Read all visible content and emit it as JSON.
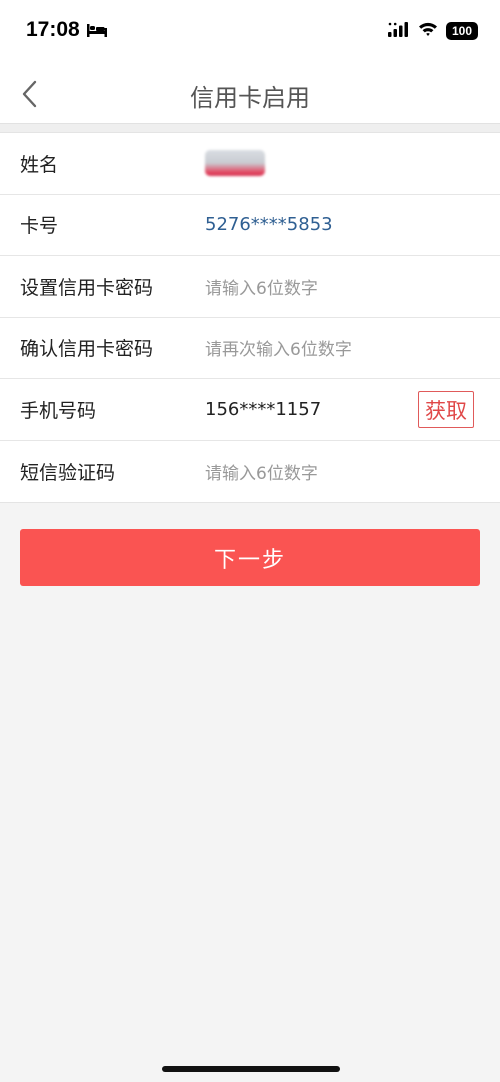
{
  "status_bar": {
    "time": "17:08",
    "battery": "100",
    "icons": [
      "bed-icon",
      "signal-icon",
      "wifi-icon",
      "battery-icon"
    ]
  },
  "nav": {
    "back_icon": "chevron-left-icon",
    "title": "信用卡启用"
  },
  "form": {
    "name": {
      "label": "姓名"
    },
    "card_number": {
      "label": "卡号",
      "value": "5276****5853"
    },
    "set_password": {
      "label": "设置信用卡密码",
      "placeholder": "请输入6位数字"
    },
    "confirm_password": {
      "label": "确认信用卡密码",
      "placeholder": "请再次输入6位数字"
    },
    "phone": {
      "label": "手机号码",
      "value": "156****1157",
      "get_code_label": "获取"
    },
    "sms_code": {
      "label": "短信验证码",
      "placeholder": "请输入6位数字"
    }
  },
  "next_button": {
    "label": "下一步"
  },
  "colors": {
    "accent": "#fa5452",
    "link": "#2f5f92",
    "background": "#f4f4f4"
  }
}
